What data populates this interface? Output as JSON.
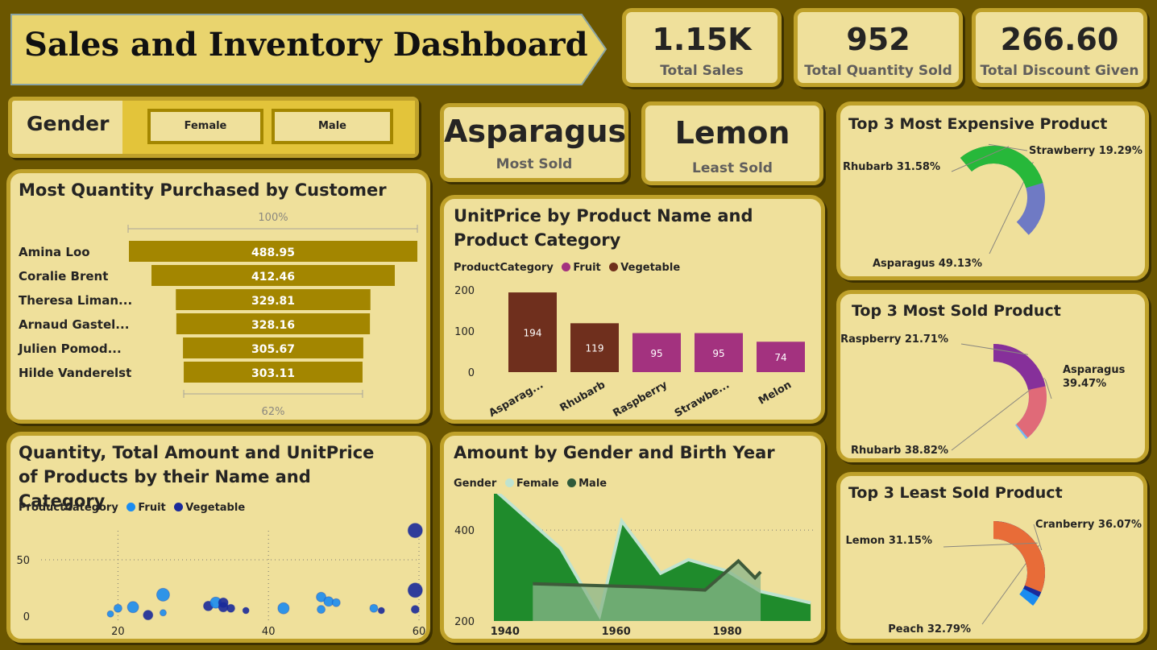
{
  "header": {
    "title": "Sales and Inventory Dashboard"
  },
  "kpis": [
    {
      "value": "1.15K",
      "label": "Total Sales"
    },
    {
      "value": "952",
      "label": "Total Quantity Sold"
    },
    {
      "value": "266.60",
      "label": "Total Discount Given"
    }
  ],
  "gender_slicer": {
    "label": "Gender",
    "options": [
      "Female",
      "Male"
    ]
  },
  "product_cards": [
    {
      "value": "Asparagus",
      "label": "Most Sold"
    },
    {
      "value": "Lemon",
      "label": "Least Sold"
    }
  ],
  "colors": {
    "bar_gold": "#a38600",
    "vegetable": "#6f2f1d",
    "fruit": "#a3327f",
    "female_area": "#1f8b2c",
    "male_area": "#5c8c5a"
  },
  "chart_data": [
    {
      "id": "funnel",
      "type": "bar",
      "title": "Most Quantity Purchased by Customer",
      "categories": [
        "Amina Loo",
        "Coralie Brent",
        "Theresa Liman...",
        "Arnaud Gastel...",
        "Julien Pomod...",
        "Hilde Vanderelst"
      ],
      "values": [
        488.95,
        412.46,
        329.81,
        328.16,
        305.67,
        303.11
      ],
      "value_labels": [
        "488.95",
        "412.46",
        "329.81",
        "328.16",
        "305.67",
        "303.11"
      ],
      "top_pct": "100%",
      "bottom_pct": "62%"
    },
    {
      "id": "unitprice",
      "type": "bar",
      "title": "UnitPrice by Product Name and Product Category",
      "legend_title": "ProductCategory",
      "legend": [
        "Fruit",
        "Vegetable"
      ],
      "categories": [
        "Asparag...",
        "Rhubarb",
        "Raspberry",
        "Strawbe...",
        "Melon"
      ],
      "values": [
        194,
        119,
        95,
        95,
        74
      ],
      "series_of": [
        "Vegetable",
        "Vegetable",
        "Fruit",
        "Fruit",
        "Fruit"
      ],
      "yticks": [
        "200",
        "100",
        "0"
      ],
      "ylim": [
        0,
        200
      ]
    },
    {
      "id": "expensive",
      "type": "pie",
      "title": "Top 3 Most Expensive Product",
      "slices": [
        {
          "label": "Strawberry 19.29%",
          "value": 19.29,
          "color": "#a38600"
        },
        {
          "label": "Asparagus 49.13%",
          "value": 49.13,
          "color": "#6f7ac4"
        },
        {
          "label": "Rhubarb 31.58%",
          "value": 31.58,
          "color": "#27b83a"
        }
      ]
    },
    {
      "id": "mostsold",
      "type": "pie",
      "title": "Top 3 Most Sold Product",
      "slices": [
        {
          "label": "Asparagus 39.47%",
          "value": 39.47,
          "color": "#74b9f5"
        },
        {
          "label": "Rhubarb 38.82%",
          "value": 38.82,
          "color": "#e06a78"
        },
        {
          "label": "Raspberry 21.71%",
          "value": 21.71,
          "color": "#86309a"
        }
      ]
    },
    {
      "id": "leastsold",
      "type": "pie",
      "title": "Top 3 Least Sold Product",
      "slices": [
        {
          "label": "Cranberry 36.07%",
          "value": 36.07,
          "color": "#1a8cf0"
        },
        {
          "label": "Peach 32.79%",
          "value": 32.79,
          "color": "#1a2a9a"
        },
        {
          "label": "Lemon 31.15%",
          "value": 31.15,
          "color": "#e86c38"
        }
      ]
    },
    {
      "id": "scatter",
      "type": "scatter",
      "title": "Quantity, Total Amount and UnitPrice of Products by their Name and Category",
      "legend_title": "ProductCategory",
      "legend": [
        "Fruit",
        "Vegetable"
      ],
      "xticks": [
        "20",
        "40",
        "60"
      ],
      "yticks": [
        "50",
        "0"
      ],
      "xlim": [
        10,
        60
      ],
      "ylim": [
        0,
        80
      ],
      "points": [
        {
          "x": 19,
          "y": 2,
          "s": 4,
          "cat": "Fruit"
        },
        {
          "x": 20,
          "y": 7,
          "s": 5,
          "cat": "Fruit"
        },
        {
          "x": 22,
          "y": 8,
          "s": 7,
          "cat": "Fruit"
        },
        {
          "x": 24,
          "y": 1,
          "s": 6,
          "cat": "Vegetable"
        },
        {
          "x": 26,
          "y": 19,
          "s": 8,
          "cat": "Fruit"
        },
        {
          "x": 26,
          "y": 3,
          "s": 4,
          "cat": "Fruit"
        },
        {
          "x": 32,
          "y": 9,
          "s": 6,
          "cat": "Vegetable"
        },
        {
          "x": 33,
          "y": 12,
          "s": 7,
          "cat": "Fruit"
        },
        {
          "x": 34,
          "y": 8,
          "s": 6,
          "cat": "Vegetable"
        },
        {
          "x": 34,
          "y": 12,
          "s": 6,
          "cat": "Vegetable"
        },
        {
          "x": 35,
          "y": 7,
          "s": 5,
          "cat": "Vegetable"
        },
        {
          "x": 37,
          "y": 5,
          "s": 4,
          "cat": "Vegetable"
        },
        {
          "x": 42,
          "y": 7,
          "s": 7,
          "cat": "Fruit"
        },
        {
          "x": 47,
          "y": 17,
          "s": 6,
          "cat": "Fruit"
        },
        {
          "x": 47,
          "y": 6,
          "s": 5,
          "cat": "Fruit"
        },
        {
          "x": 48,
          "y": 13,
          "s": 6,
          "cat": "Fruit"
        },
        {
          "x": 49,
          "y": 12,
          "s": 5,
          "cat": "Fruit"
        },
        {
          "x": 54,
          "y": 7,
          "s": 5,
          "cat": "Fruit"
        },
        {
          "x": 55,
          "y": 5,
          "s": 4,
          "cat": "Vegetable"
        },
        {
          "x": 59.5,
          "y": 23,
          "s": 9,
          "cat": "Vegetable"
        },
        {
          "x": 59.5,
          "y": 6,
          "s": 5,
          "cat": "Vegetable"
        },
        {
          "x": 59.5,
          "y": 76,
          "s": 9,
          "cat": "Vegetable"
        }
      ]
    },
    {
      "id": "area",
      "type": "area",
      "title": "Amount by Gender and Birth Year",
      "legend_title": "Gender",
      "legend": [
        "Female",
        "Male"
      ],
      "xticks": [
        "1940",
        "1960",
        "1980"
      ],
      "yticks": [
        "400",
        "200"
      ],
      "xlim": [
        1938,
        1996
      ],
      "ylim": [
        200,
        480
      ],
      "series": [
        {
          "name": "Female",
          "x": [
            1938,
            1950,
            1957,
            1961,
            1968,
            1973,
            1980,
            1986,
            1995
          ],
          "y": [
            490,
            360,
            212,
            420,
            305,
            335,
            310,
            265,
            240
          ]
        },
        {
          "name": "Male",
          "x": [
            1945,
            1965,
            1976,
            1982,
            1985,
            1986
          ],
          "y": [
            282,
            275,
            268,
            332,
            295,
            308
          ]
        }
      ]
    }
  ]
}
